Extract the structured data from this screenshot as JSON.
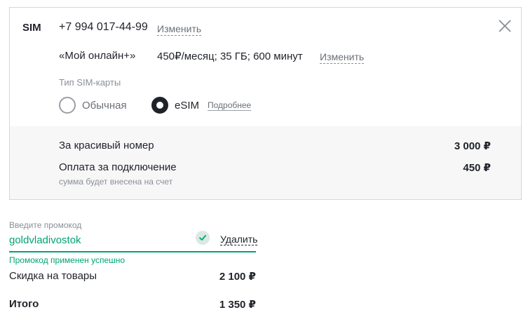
{
  "sim": {
    "label": "SIM",
    "phone": "+7 994 017-44-99",
    "change_phone": "Изменить",
    "tariff_name": "«Мой онлайн+»",
    "tariff_info": "450₽/месяц; 35 ГБ; 600 минут",
    "change_tariff": "Изменить",
    "sim_type_label": "Тип SIM-карты",
    "sim_types": [
      {
        "label": "Обычная",
        "selected": false
      },
      {
        "label": "eSIM",
        "selected": true
      }
    ],
    "more_link": "Подробнее"
  },
  "fees": [
    {
      "label": "За красивый номер",
      "price": "3 000 ₽"
    },
    {
      "label": "Оплата за подключение",
      "price": "450 ₽",
      "note": "сумма будет внесена на счет"
    }
  ],
  "promo": {
    "label": "Введите промокод",
    "value": "goldvladivostok",
    "delete_label": "Удалить",
    "status": "Промокод применен успешно"
  },
  "summary": {
    "discount_label": "Скидка на товары",
    "discount_value": "2 100 ₽",
    "total_label": "Итого",
    "total_value": "1 350 ₽"
  },
  "colors": {
    "accent_green": "#00a473",
    "text": "#1f2229",
    "muted": "#8a8f96"
  }
}
